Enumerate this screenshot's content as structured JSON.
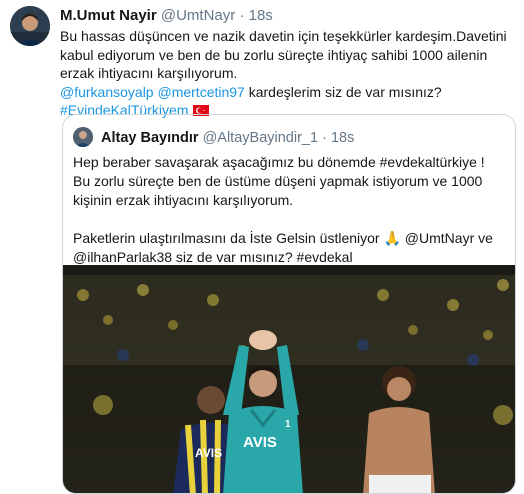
{
  "tweet": {
    "author_name": "M.Umut Nayir",
    "author_handle": "@UmtNayr",
    "separator": "·",
    "time": "18s",
    "body_line1": "Bu hassas düşüncen ve nazik davetin için teşekkürler kardeşim.Davetini kabul ediyorum ve ben de bu zorlu süreçte ihtiyaç sahibi 1000 ailenin erzak ihtiyacını karşılıyorum.",
    "mention1": "@furkansoyalp",
    "mention2": "@mertcetin97",
    "mention_suffix": " kardeşlerim siz de var mısınız?",
    "hashtag": "#EvindeKalTürkiyem"
  },
  "quoted": {
    "author_name": "Altay Bayındır",
    "author_handle": "@AltayBayindir_1",
    "separator": "·",
    "time": "18s",
    "paragraph1": "Hep beraber savaşarak aşacağımız bu dönemde #evdekaltürkiye ! Bu zorlu süreçte ben de üstüme düşeni yapmak istiyorum ve 1000 kişinin erzak ihtiyacını karşılıyorum.",
    "paragraph2_a": "Paketlerin ulaştırılmasını da İste Gelsin üstleniyor ",
    "paragraph2_emoji": "🙏",
    "paragraph2_b": " @UmtNayr ve @ilhanParlak38 siz de var mısınız? #evdekal",
    "photo_text": {
      "sponsor": "AVIS",
      "player_number": "1",
      "sponsor_back": "AVIS"
    }
  },
  "colors": {
    "link": "#1b95e0",
    "text": "#14171a",
    "muted": "#657786",
    "border": "#ccd6dd",
    "flag_red": "#e30a17"
  },
  "icons": {
    "flag": "turkey-flag-icon",
    "verified": "none"
  }
}
